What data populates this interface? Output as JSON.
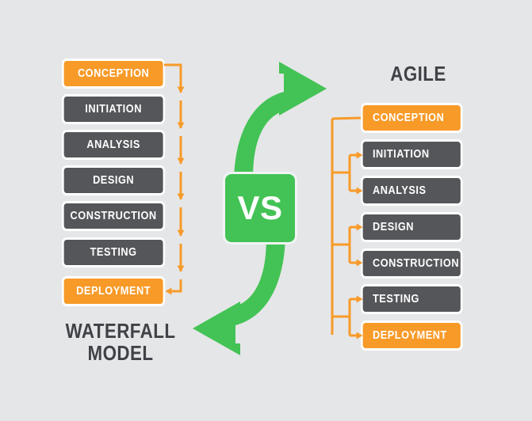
{
  "background_color": "#e5e6e8",
  "palette": {
    "accent_orange": "#f79a28",
    "box_dark_gray": "#55565a",
    "green": "#43c355",
    "title_text": "#414247",
    "box_border": "#ffffff"
  },
  "center": {
    "badge_label": "VS",
    "badge_color": "#43c355",
    "arrow_top_name": "green-arrow-to-agile",
    "arrow_bottom_name": "green-arrow-to-waterfall"
  },
  "waterfall": {
    "title": "WATERFALL\nMODEL",
    "title_line1": "WATERFALL",
    "title_line2": "MODEL",
    "phases": [
      {
        "label": "CONCEPTION",
        "highlighted": true
      },
      {
        "label": "INITIATION",
        "highlighted": false
      },
      {
        "label": "ANALYSIS",
        "highlighted": false
      },
      {
        "label": "DESIGN",
        "highlighted": false
      },
      {
        "label": "CONSTRUCTION",
        "highlighted": false
      },
      {
        "label": "TESTING",
        "highlighted": false
      },
      {
        "label": "DEPLOYMENT",
        "highlighted": true
      }
    ],
    "flow_type": "sequential-downward",
    "arrow_count": 6
  },
  "agile": {
    "title": "AGILE",
    "phases": [
      {
        "label": "CONCEPTION",
        "highlighted": true
      },
      {
        "label": "INITIATION",
        "highlighted": false
      },
      {
        "label": "ANALYSIS",
        "highlighted": false
      },
      {
        "label": "DESIGN",
        "highlighted": false
      },
      {
        "label": "CONSTRUCTION",
        "highlighted": false
      },
      {
        "label": "TESTING",
        "highlighted": false
      },
      {
        "label": "DEPLOYMENT",
        "highlighted": true
      }
    ],
    "flow_type": "iterative-branching",
    "branch_count": 3
  }
}
